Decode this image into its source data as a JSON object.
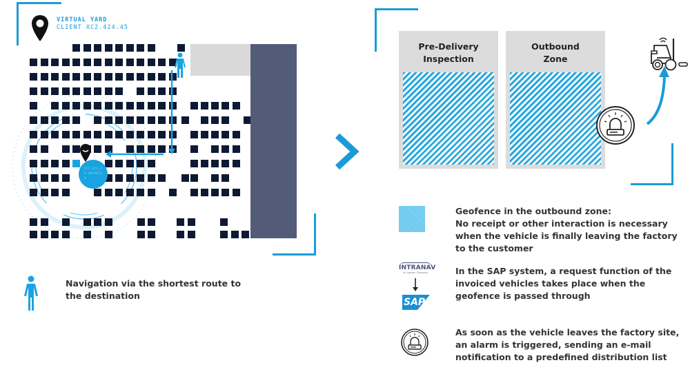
{
  "yard": {
    "title": "VIRTUAL YARD",
    "client": "CLIENT XC2.424.45",
    "destination_label": "XC2.424.45 ABCDEFGH",
    "slot_rows": [
      "....########......",
      "##############....",
      "##############....",
      "#########.####....",
      "#.############.#####",
      "#####.#########.###.#",
      "##############.#####",
      "##.#####.#####.#.###",
      "####H..#####...#####",
      "####...######.##.##",
      "####..######.#.#####"
    ]
  },
  "zones": [
    {
      "title_line1": "Pre-Delivery",
      "title_line2": "Inspection"
    },
    {
      "title_line1": "Outbound",
      "title_line2": "Zone"
    }
  ],
  "legend": {
    "navigation": "Navigation via the shortest route to the destination",
    "geofence_title": "Geofence in the outbound zone:",
    "geofence_body": "No receipt or other interaction is necessary when the vehicle is finally leaving the factory to the customer",
    "sap": "In the SAP system, a request function of the invoiced vehicles takes place when the geofence is passed through",
    "alarm": "As soon as the vehicle leaves the factory site, an alarm is triggered, sending an e-mail notification to a predefined distribution list"
  },
  "logos": {
    "intranav": "INTRANAV",
    "intranav_tagline": "An Inpixon Company",
    "sap": "SAP"
  },
  "icons": {
    "location_pin": "map-pin-icon",
    "person": "person-icon",
    "next": "chevron-right-icon",
    "forklift": "forklift-icon",
    "alarm": "alarm-siren-icon"
  },
  "colors": {
    "accent": "#1a9bd7",
    "slot": "#0e1a33",
    "building": "#525c78",
    "zone_bg": "#dcdcdc"
  }
}
